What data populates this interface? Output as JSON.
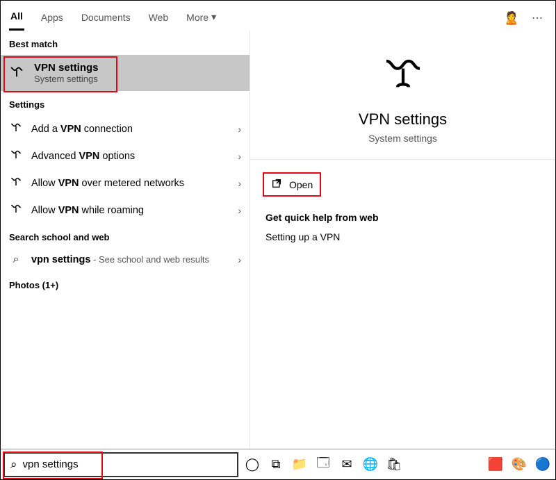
{
  "tabs": {
    "all": "All",
    "apps": "Apps",
    "documents": "Documents",
    "web": "Web",
    "more": "More"
  },
  "sections": {
    "best_match": "Best match",
    "settings": "Settings",
    "search_web": "Search school and web",
    "photos": "Photos (1+)"
  },
  "best_match": {
    "title": "VPN settings",
    "subtitle": "System settings"
  },
  "settings_items": [
    {
      "prefix": "Add a ",
      "bold": "VPN",
      "suffix": " connection"
    },
    {
      "prefix": "Advanced ",
      "bold": "VPN",
      "suffix": " options"
    },
    {
      "prefix": "Allow ",
      "bold": "VPN",
      "suffix": " over metered networks"
    },
    {
      "prefix": "Allow ",
      "bold": "VPN",
      "suffix": " while roaming"
    }
  ],
  "web_item": {
    "bold": "vpn settings",
    "suffix": " - See school and web results"
  },
  "preview": {
    "title": "VPN settings",
    "subtitle": "System settings",
    "open_label": "Open"
  },
  "help": {
    "header": "Get quick help from web",
    "item": "Setting up a VPN"
  },
  "search": {
    "value": "vpn settings"
  },
  "icons": {
    "chevron": "›",
    "search": "⌕",
    "cortana": "◯",
    "taskview": "⧉",
    "more_dots": "⋯",
    "dropdown": "▾"
  }
}
